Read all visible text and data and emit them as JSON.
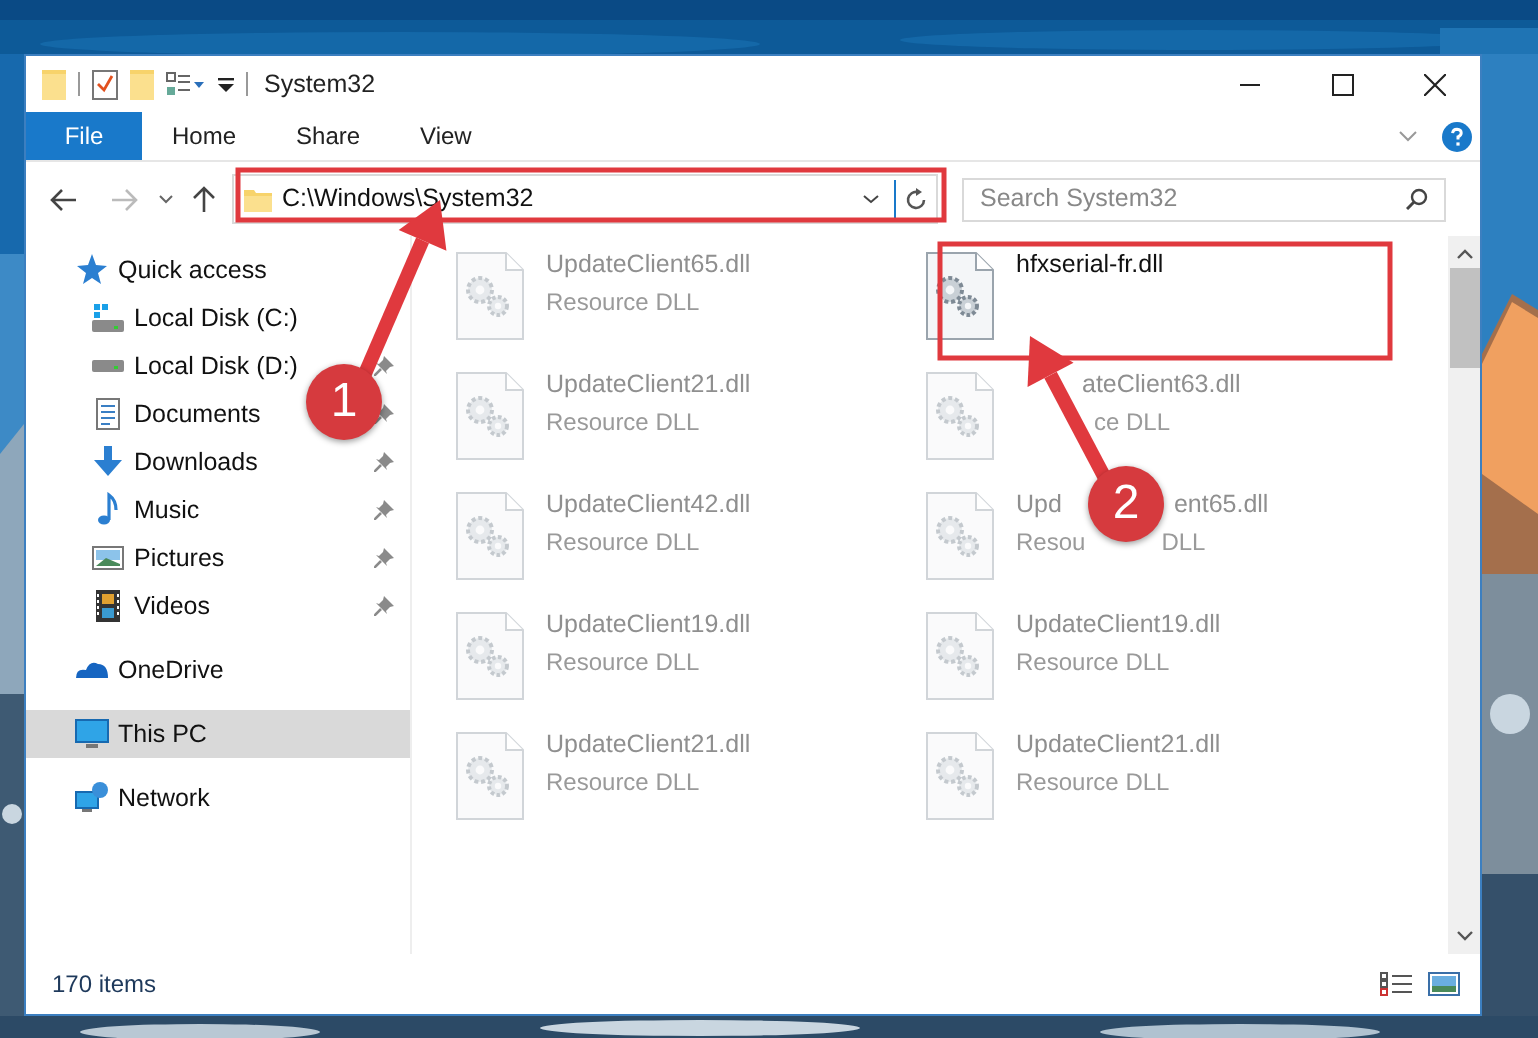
{
  "window": {
    "title": "System32"
  },
  "ribbon_tabs": [
    {
      "label": "File",
      "kind": "file"
    },
    {
      "label": "Home",
      "kind": "tab"
    },
    {
      "label": "Share",
      "kind": "tab"
    },
    {
      "label": "View",
      "kind": "tab"
    }
  ],
  "address_bar": {
    "path": "C:\\Windows\\System32"
  },
  "search": {
    "placeholder": "Search System32"
  },
  "navigation": [
    {
      "label": "Quick access",
      "kind": "star",
      "selected": false,
      "children": [
        {
          "label": "Local Disk (C:)",
          "kind": "drive_windows",
          "pinned": false
        },
        {
          "label": "Local Disk (D:)",
          "kind": "drive",
          "pinned": true
        },
        {
          "label": "Documents",
          "kind": "document",
          "pinned": true
        },
        {
          "label": "Downloads",
          "kind": "download",
          "pinned": true
        },
        {
          "label": "Music",
          "kind": "music",
          "pinned": true
        },
        {
          "label": "Pictures",
          "kind": "pictures",
          "pinned": true
        },
        {
          "label": "Videos",
          "kind": "video",
          "pinned": true
        }
      ]
    },
    {
      "label": "OneDrive",
      "kind": "cloud",
      "selected": false
    },
    {
      "label": "This PC",
      "kind": "computer",
      "selected": true
    },
    {
      "label": "Network",
      "kind": "network",
      "selected": false
    }
  ],
  "files": [
    {
      "name": "UpdateClient65.dll",
      "type": "Resource DLL",
      "blurred": true
    },
    {
      "name": "hfxserial-fr.dll",
      "blurred": false
    },
    {
      "name": "UpdateClient21.dll",
      "type": "Resource DLL",
      "blurred": true
    },
    {
      "name": "ateClient63.dll",
      "type": "ce DLL",
      "blurred": true
    },
    {
      "name": "UpdateClient42.dll",
      "type": "Resource DLL",
      "blurred": true
    },
    {
      "name": "Upd",
      "name_end": "ent65.dll",
      "type": "Resou",
      "type_end": "DLL",
      "blurred": true
    },
    {
      "name": "UpdateClient19.dll",
      "type": "Resource DLL",
      "blurred": true
    },
    {
      "name": "UpdateClient19.dll",
      "type": "Resource DLL",
      "blurred": true
    },
    {
      "name": "UpdateClient21.dll",
      "type": "Resource DLL",
      "blurred": true
    },
    {
      "name": "UpdateClient21.dll",
      "type": "Resource DLL",
      "blurred": true
    }
  ],
  "status_bar": {
    "item_count": "170 items"
  },
  "annotations": [
    {
      "number": "1"
    },
    {
      "number": "2"
    }
  ]
}
